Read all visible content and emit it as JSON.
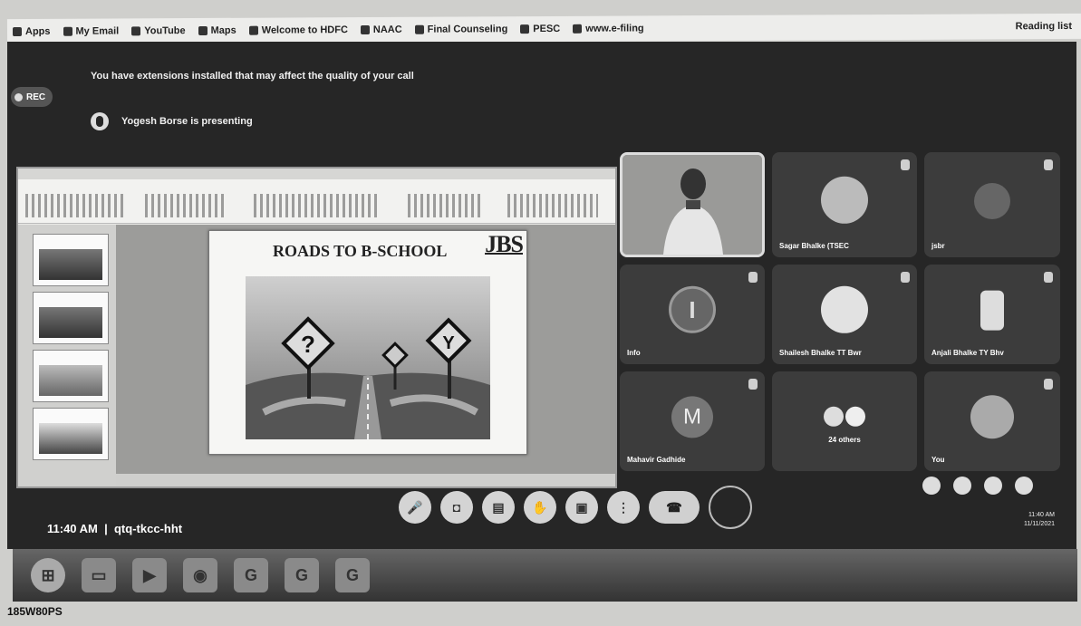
{
  "browser": {
    "bookmarks": [
      {
        "label": "Apps",
        "icon": "apps-icon"
      },
      {
        "label": "My Email",
        "icon": "email-icon"
      },
      {
        "label": "YouTube",
        "icon": "youtube-icon"
      },
      {
        "label": "Maps",
        "icon": "maps-icon"
      },
      {
        "label": "Welcome to HDFC",
        "icon": "bank-icon"
      },
      {
        "label": "NAAC",
        "icon": "globe-icon"
      },
      {
        "label": "Final Counseling",
        "icon": "doc-icon"
      },
      {
        "label": "PESC",
        "icon": "globe-icon"
      },
      {
        "label": "www.e-filing",
        "icon": "globe-icon"
      }
    ],
    "right_bookmark": "Reading list"
  },
  "meet": {
    "recording_label": "REC",
    "extension_notice": "You have extensions installed that may affect the quality of your call",
    "presenting_text": "Yogesh Borse is presenting",
    "meeting_time": "11:40 AM",
    "meeting_code": "qtq-tkcc-hht",
    "participants": [
      {
        "name": "",
        "type": "video"
      },
      {
        "name": "Sagar Bhalke (TSEC",
        "type": "avatar"
      },
      {
        "name": "jsbr",
        "type": "avatar"
      },
      {
        "name": "Info",
        "type": "letter",
        "letter": "I"
      },
      {
        "name": "Shailesh Bhalke TT Bwr",
        "type": "avatar"
      },
      {
        "name": "Anjali Bhalke TY Bhv",
        "type": "avatar"
      },
      {
        "name": "Mahavir Gadhide",
        "type": "letter",
        "letter": "M"
      },
      {
        "name": "24 others",
        "type": "group"
      },
      {
        "name": "You",
        "type": "avatar"
      }
    ],
    "controls": [
      {
        "name": "mic-button",
        "glyph": "🎤"
      },
      {
        "name": "camera-button",
        "glyph": "◘"
      },
      {
        "name": "captions-button",
        "glyph": "▤"
      },
      {
        "name": "raise-hand-button",
        "glyph": "✋"
      },
      {
        "name": "present-button",
        "glyph": "▣"
      },
      {
        "name": "more-options-button",
        "glyph": "⋮"
      }
    ]
  },
  "slide": {
    "title": "ROADS TO B-SCHOOL",
    "logo": "JBS"
  },
  "taskbar": {
    "clock_time": "11:40 AM",
    "clock_date": "11/11/2021"
  },
  "photo_caption": "185W80PS"
}
